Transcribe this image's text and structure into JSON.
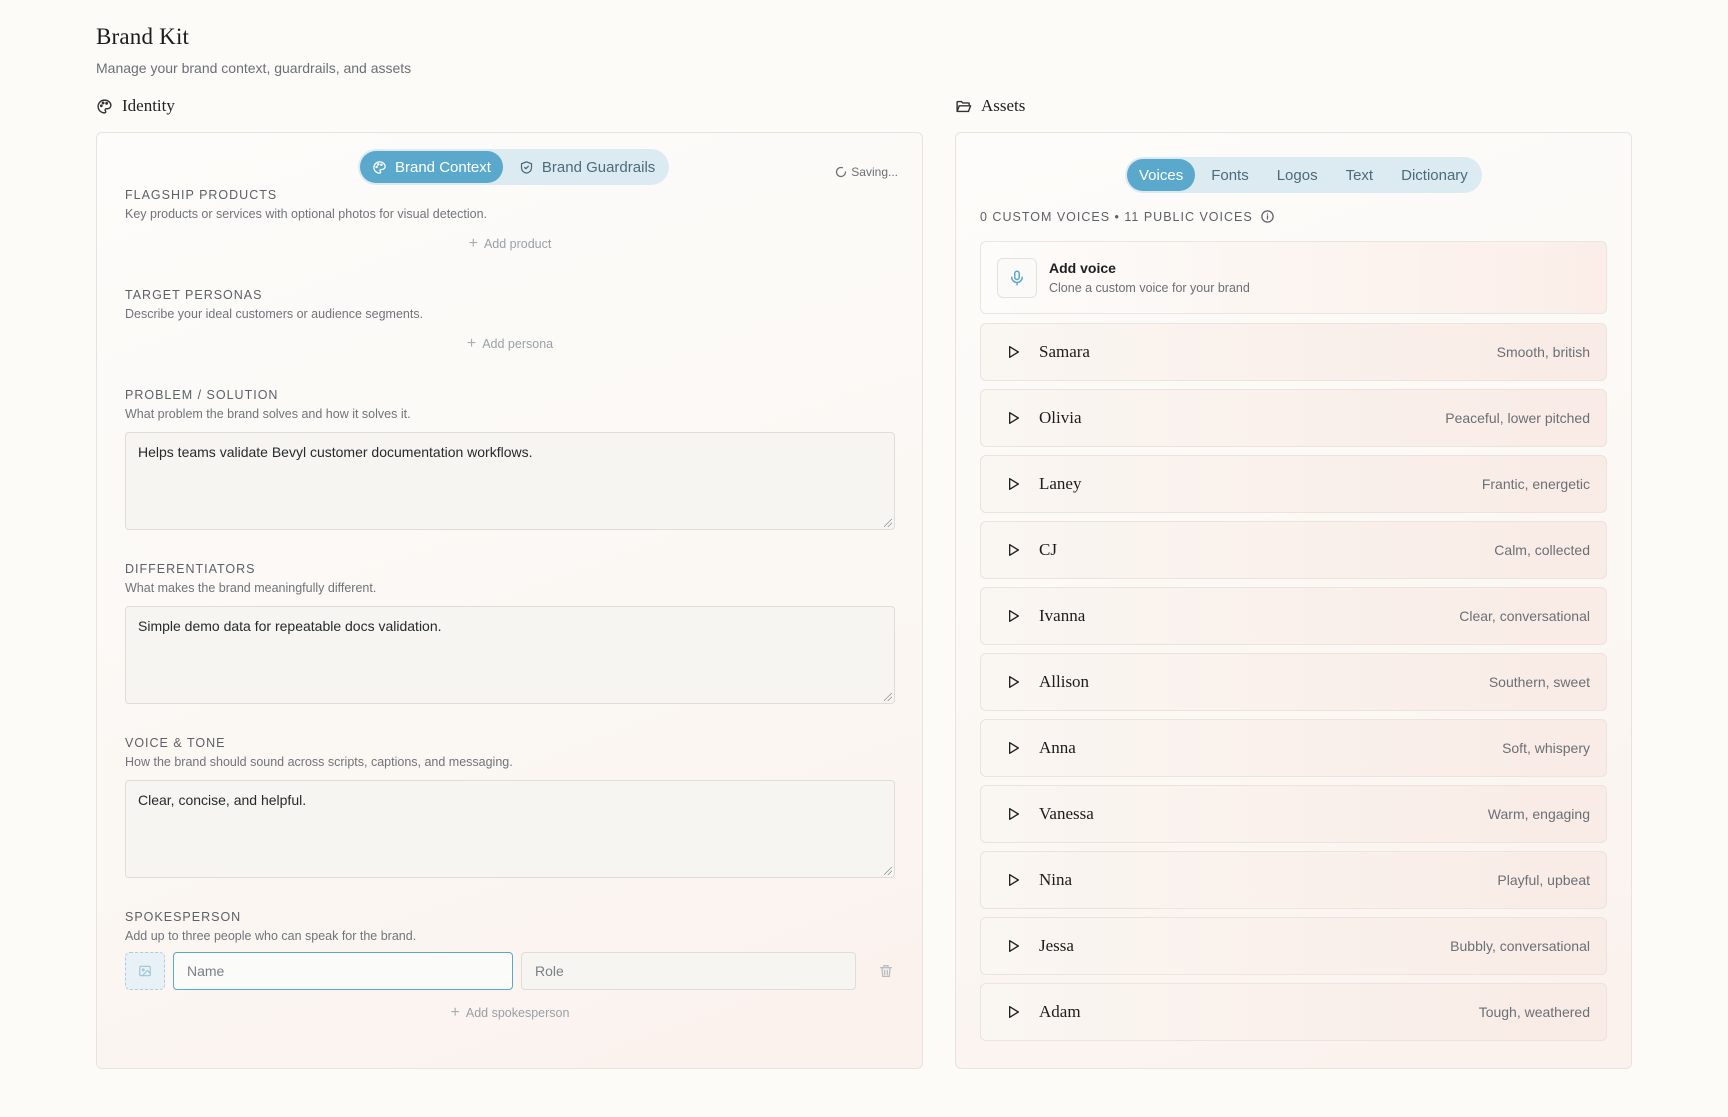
{
  "header": {
    "title": "Brand Kit",
    "subtitle": "Manage your brand context, guardrails, and assets"
  },
  "identity": {
    "heading": "Identity",
    "tabs": {
      "brand_context": "Brand Context",
      "brand_guardrails": "Brand Guardrails",
      "active": "brand_context"
    },
    "saving": "Saving...",
    "flagship": {
      "label": "FLAGSHIP PRODUCTS",
      "help": "Key products or services with optional photos for visual detection.",
      "add": "Add product"
    },
    "personas": {
      "label": "TARGET PERSONAS",
      "help": "Describe your ideal customers or audience segments.",
      "add": "Add persona"
    },
    "problem": {
      "label": "PROBLEM / SOLUTION",
      "help": "What problem the brand solves and how it solves it.",
      "value": "Helps teams validate Bevyl customer documentation workflows."
    },
    "differentiators": {
      "label": "DIFFERENTIATORS",
      "help": "What makes the brand meaningfully different.",
      "value": "Simple demo data for repeatable docs validation."
    },
    "voice_tone": {
      "label": "VOICE & TONE",
      "help": "How the brand should sound across scripts, captions, and messaging.",
      "value": "Clear, concise, and helpful."
    },
    "spokesperson": {
      "label": "SPOKESPERSON",
      "help": "Add up to three people who can speak for the brand.",
      "name_placeholder": "Name",
      "role_placeholder": "Role",
      "add": "Add spokesperson"
    }
  },
  "assets": {
    "heading": "Assets",
    "tabs": [
      "Voices",
      "Fonts",
      "Logos",
      "Text",
      "Dictionary"
    ],
    "active_tab": "Voices",
    "counts": "0 CUSTOM VOICES • 11 PUBLIC VOICES",
    "add_voice": {
      "title": "Add voice",
      "subtitle": "Clone a custom voice for your brand"
    },
    "voices": [
      {
        "name": "Samara",
        "desc": "Smooth, british"
      },
      {
        "name": "Olivia",
        "desc": "Peaceful, lower pitched"
      },
      {
        "name": "Laney",
        "desc": "Frantic, energetic"
      },
      {
        "name": "CJ",
        "desc": "Calm, collected"
      },
      {
        "name": "Ivanna",
        "desc": "Clear, conversational"
      },
      {
        "name": "Allison",
        "desc": "Southern, sweet"
      },
      {
        "name": "Anna",
        "desc": "Soft, whispery"
      },
      {
        "name": "Vanessa",
        "desc": "Warm, engaging"
      },
      {
        "name": "Nina",
        "desc": "Playful, upbeat"
      },
      {
        "name": "Jessa",
        "desc": "Bubbly, conversational"
      },
      {
        "name": "Adam",
        "desc": "Tough, weathered"
      }
    ]
  },
  "colors": {
    "accent": "#5aa9cc",
    "accent_soft": "#dcebf2"
  },
  "icons": {
    "identity": "palette-icon",
    "assets": "folder-open-icon",
    "brand_context": "palette-icon",
    "brand_guardrails": "shield-check-icon",
    "saving": "spinner-icon",
    "info": "info-icon",
    "mic": "mic-icon",
    "play": "play-icon",
    "trash": "trash-icon",
    "image": "image-icon"
  }
}
